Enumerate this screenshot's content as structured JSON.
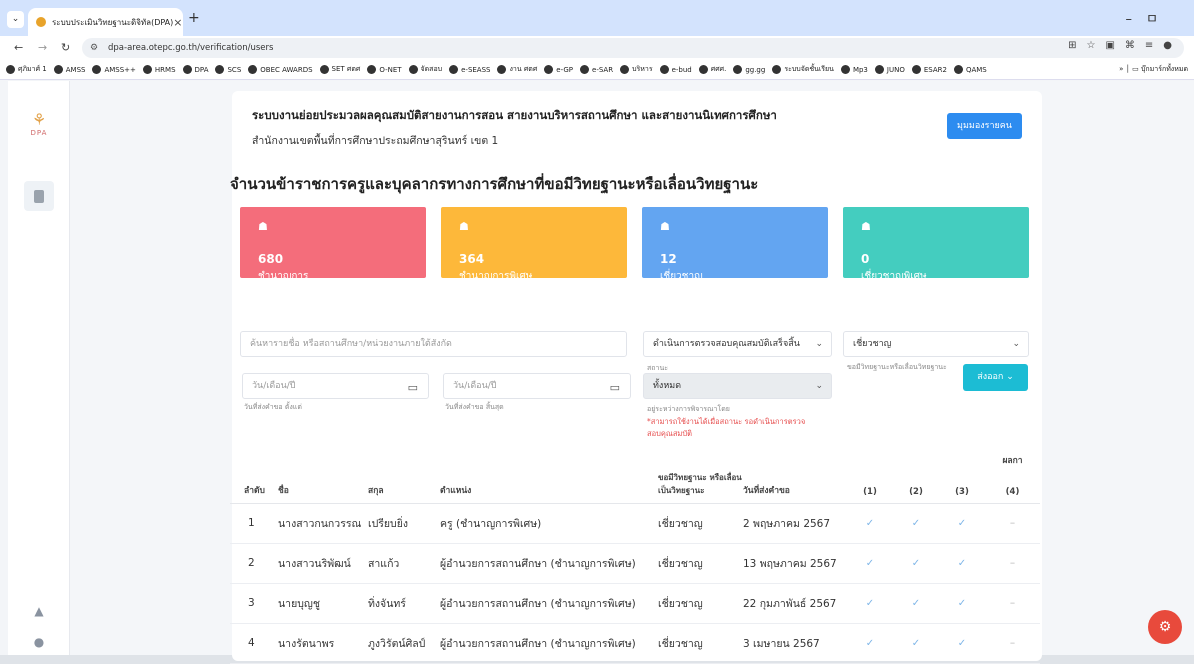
{
  "browser": {
    "tab_title": "ระบบประเมินวิทยฐานะดิจิทัล(DPA)",
    "url": "dpa-area.otepc.go.th/verification/users",
    "bookmarks": [
      "ศุภิมาศ์ 1",
      "AMSS",
      "AMSS++",
      "HRMS",
      "DPA",
      "SCS",
      "OBEC AWARDS",
      "SET ศตศ",
      "O-NET",
      "จัดสอบ",
      "e-SEASS",
      "งาน ศตศ",
      "e-GP",
      "e-SAR",
      "บริหาร",
      "e-bud",
      "ศศศ.",
      "gg.gg",
      "ระบบจัดชั้นเรียน",
      "Mp3",
      "JUNO",
      "ESAR2",
      "QAMS"
    ],
    "bookmarks_more": "บุ๊กมาร์กทั้งหมด"
  },
  "app": {
    "logo_text": "DPA",
    "header_title": "ระบบงานย่อยประมวลผลคุณสมบัติสายงานการสอน สายงานบริหารสถานศึกษา และสายงานนิเทศการศึกษา",
    "header_subtitle": "สำนักงานเขตพื้นที่การศึกษาประถมศึกษาสุรินทร์ เขต 1",
    "view_button": "มุมมองรายคน",
    "section_title": "จำนวนข้าราชการครูและบุคลากรทางการศึกษาที่ขอมีวิทยฐานะหรือเลื่อนวิทยฐานะ"
  },
  "cards": [
    {
      "value": "680",
      "label": "ชำนาญการ"
    },
    {
      "value": "364",
      "label": "ชำนาญการพิเศษ"
    },
    {
      "value": "12",
      "label": "เชี่ยวชาญ"
    },
    {
      "value": "0",
      "label": "เชี่ยวชาญพิเศษ"
    }
  ],
  "filters": {
    "search_placeholder": "ค้นหารายชื่อ หรือสถานศึกษา/หน่วยงานภายใต้สังกัด",
    "process_select": "ดำเนินการตรวจสอบคุณสมบัติเสร็จสิ้น",
    "level_select": "เชี่ยวชาญ",
    "level_help": "ขอมีวิทยฐานะหรือเลื่อนวิทยฐานะ",
    "status_label": "สถานะ",
    "status_select": "ทั้งหมด",
    "status_help": "อยู่ระหว่างการพิจารณาโดย",
    "status_warning": "*สามารถใช้งานได้เมื่อสถานะ รอดำเนินการตรวจสอบคุณสมบัติ",
    "date_start_placeholder": "วัน/เดือน/ปี",
    "date_start_help": "วันที่ส่งคำขอ ตั้งแต่",
    "date_end_placeholder": "วัน/เดือน/ปี",
    "date_end_help": "วันที่ส่งคำขอ สิ้นสุด",
    "export_button": "ส่งออก"
  },
  "table": {
    "headers": {
      "no": "ลำดับ",
      "name": "ชื่อ",
      "surname": "สกุล",
      "position": "ตำแหน่ง",
      "level": "ขอมีวิทยฐานะ หรือเลื่อน เป็นวิทยฐานะ",
      "date": "วันที่ส่งคำขอ",
      "result": "ผลกา",
      "c1": "(1)",
      "c2": "(2)",
      "c3": "(3)",
      "c4": "(4)"
    },
    "rows": [
      {
        "no": "1",
        "name": "นางสาวกนกวรรณ",
        "surname": "เปรียบยิ่ง",
        "position": "ครู (ชำนาญการพิเศษ)",
        "level": "เชี่ยวชาญ",
        "date": "2 พฤษภาคม 2567"
      },
      {
        "no": "2",
        "name": "นางสาวนริพัฒน์",
        "surname": "สาแก้ว",
        "position": "ผู้อำนวยการสถานศึกษา (ชำนาญการพิเศษ)",
        "level": "เชี่ยวชาญ",
        "date": "13 พฤษภาคม 2567"
      },
      {
        "no": "3",
        "name": "นายบุญชู",
        "surname": "ทิ่งจันทร์",
        "position": "ผู้อำนวยการสถานศึกษา (ชำนาญการพิเศษ)",
        "level": "เชี่ยวชาญ",
        "date": "22 กุมภาพันธ์ 2567"
      },
      {
        "no": "4",
        "name": "นางรัตนาพร",
        "surname": "ภูงวิรัตน์ศิลป์",
        "position": "ผู้อำนวยการสถานศึกษา (ชำนาญการพิเศษ)",
        "level": "เชี่ยวชาญ",
        "date": "3 เมษายน 2567"
      }
    ]
  }
}
